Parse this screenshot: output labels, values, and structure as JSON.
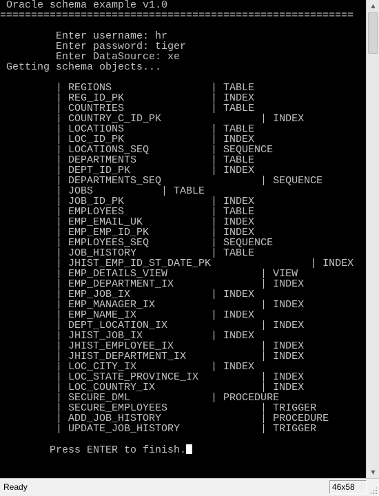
{
  "console": {
    "lines": [
      " Oracle schema example v1.0",
      "=========================================================",
      "",
      "         Enter username: hr",
      "         Enter password: tiger",
      "         Enter DataSource: xe",
      " Getting schema objects...",
      "",
      "         | REGIONS                | TABLE",
      "         | REG_ID_PK              | INDEX",
      "         | COUNTRIES              | TABLE",
      "         | COUNTRY_C_ID_PK                | INDEX",
      "         | LOCATIONS              | TABLE",
      "         | LOC_ID_PK              | INDEX",
      "         | LOCATIONS_SEQ          | SEQUENCE",
      "         | DEPARTMENTS            | TABLE",
      "         | DEPT_ID_PK             | INDEX",
      "         | DEPARTMENTS_SEQ                | SEQUENCE",
      "         | JOBS           | TABLE",
      "         | JOB_ID_PK              | INDEX",
      "         | EMPLOYEES              | TABLE",
      "         | EMP_EMAIL_UK           | INDEX",
      "         | EMP_EMP_ID_PK          | INDEX",
      "         | EMPLOYEES_SEQ          | SEQUENCE",
      "         | JOB_HISTORY            | TABLE",
      "         | JHIST_EMP_ID_ST_DATE_PK                | INDEX",
      "         | EMP_DETAILS_VIEW               | VIEW",
      "         | EMP_DEPARTMENT_IX              | INDEX",
      "         | EMP_JOB_IX             | INDEX",
      "         | EMP_MANAGER_IX                 | INDEX",
      "         | EMP_NAME_IX            | INDEX",
      "         | DEPT_LOCATION_IX               | INDEX",
      "         | JHIST_JOB_IX           | INDEX",
      "         | JHIST_EMPLOYEE_IX              | INDEX",
      "         | JHIST_DEPARTMENT_IX            | INDEX",
      "         | LOC_CITY_IX            | INDEX",
      "         | LOC_STATE_PROVINCE_IX          | INDEX",
      "         | LOC_COUNTRY_IX                 | INDEX",
      "         | SECURE_DML             | PROCEDURE",
      "         | SECURE_EMPLOYEES               | TRIGGER",
      "         | ADD_JOB_HISTORY                | PROCEDURE",
      "         | UPDATE_JOB_HISTORY             | TRIGGER",
      "",
      "        Press ENTER to finish."
    ],
    "text_color": "#c0c0c0",
    "background": "#000000",
    "cursor_color": "#ffffff"
  },
  "statusbar": {
    "status": "Ready",
    "size": "46x58"
  },
  "scrollbar": {
    "up_icon": "arrow-up-icon",
    "down_icon": "arrow-down-icon"
  }
}
